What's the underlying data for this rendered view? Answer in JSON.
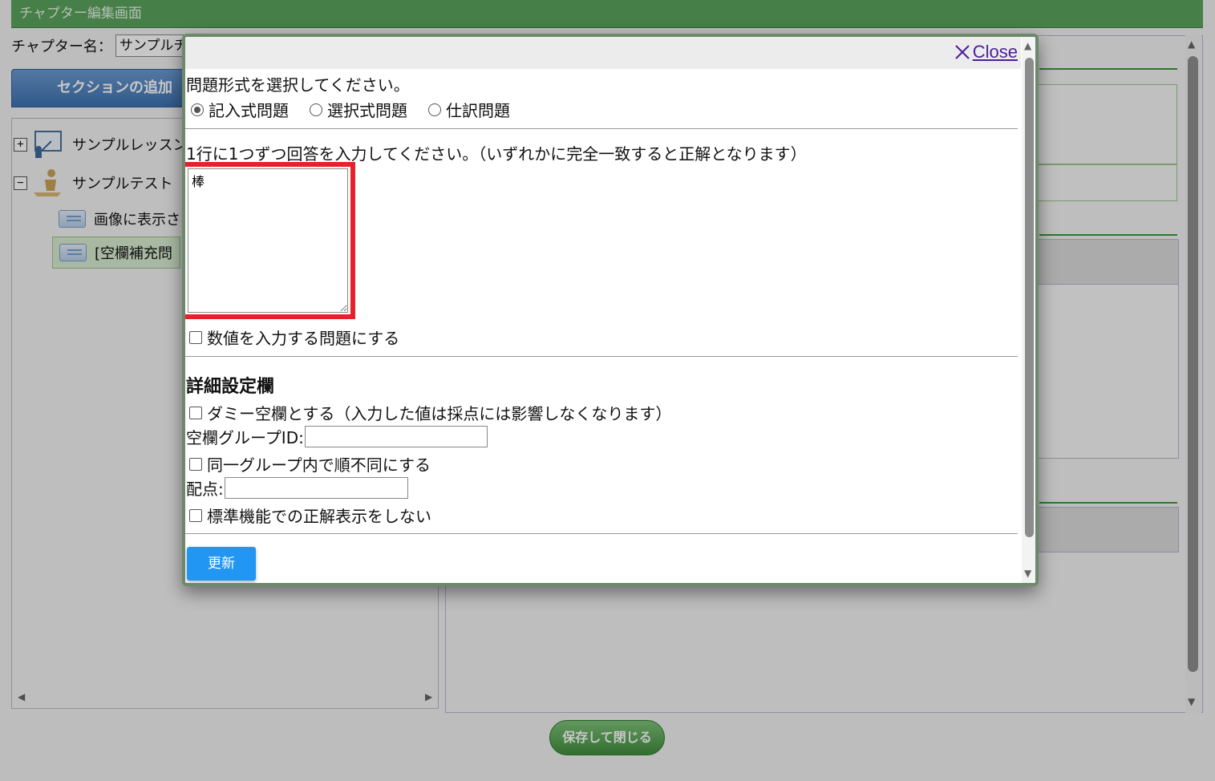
{
  "page": {
    "title": "チャプター編集画面",
    "chapter_label": "チャプター名：",
    "chapter_value": "サンプルチ",
    "add_section_label": "セクションの追加",
    "save_close_label": "保存して閉じる"
  },
  "tree": {
    "items": [
      {
        "label": "サンプルレッスン"
      },
      {
        "label": "サンプルテスト"
      },
      {
        "label": "画像に表示さ"
      },
      {
        "label": "[空欄補充問"
      }
    ]
  },
  "modal": {
    "close_label": "Close",
    "question_type_prompt": "問題形式を選択してください。",
    "question_types": [
      {
        "label": "記入式問題",
        "selected": true
      },
      {
        "label": "選択式問題",
        "selected": false
      },
      {
        "label": "仕訳問題",
        "selected": false
      }
    ],
    "answer_prompt": "1行に1つずつ回答を入力してください。（いずれかに完全一致すると正解となります）",
    "answer_value": "棒",
    "numeric_checkbox_label": "数値を入力する問題にする",
    "details_heading": "詳細設定欄",
    "dummy_checkbox_label": "ダミー空欄とする（入力した値は採点には影響しなくなります）",
    "group_id_label": "空欄グループID:",
    "group_id_value": "",
    "unordered_checkbox_label": "同一グループ内で順不同にする",
    "score_label": "配点:",
    "score_value": "",
    "hide_answer_checkbox_label": "標準機能での正解表示をしない",
    "update_label": "更新"
  },
  "colors": {
    "header_green": "#5aa35c",
    "update_blue": "#2196f3",
    "highlight_red": "#e8202b",
    "close_link": "#4b1f9a"
  }
}
